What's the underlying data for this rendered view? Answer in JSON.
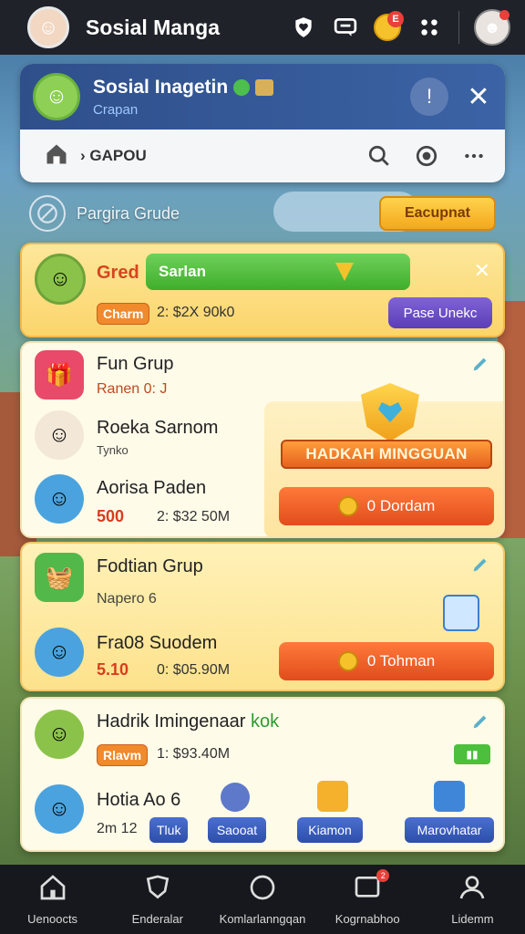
{
  "header": {
    "title": "Sosial Manga",
    "coin_badge": "E"
  },
  "group_header": {
    "name": "Sosial Inagetin",
    "subtitle": "Crapan",
    "breadcrumb": "GAPOU",
    "breadcrumb_sep": "›"
  },
  "filter": {
    "label": "Pargira Grude",
    "button": "Eacupnat"
  },
  "featured": {
    "name": "Gred",
    "bar_label": "Sarlan",
    "chip": "Charm",
    "stat": "2: $2X 90k0",
    "button": "Pase Unekc"
  },
  "group1": {
    "title": "Fun Grup",
    "subtitle": "Ranen 0: J",
    "member1": {
      "name": "Roeka Sarnom",
      "sub": "Tynko"
    },
    "member2": {
      "name": "Aorisa Paden",
      "num": "500",
      "stat": "2: $32 50M"
    },
    "promo": {
      "banner": "HADKAH MINGGUAN",
      "button": "0 Dordam"
    }
  },
  "group2": {
    "title": "Fodtian Grup",
    "subtitle": "Napero 6",
    "member": {
      "name": "Fra08 Suodem",
      "num": "5.10",
      "stat": "0: $05.90M"
    },
    "button": "0 Tohman"
  },
  "group3": {
    "title": "Hadrik Imingenaar",
    "title_accent": "kok",
    "chip": "Rlavm",
    "stat": "1: $93.40M",
    "member": {
      "name": "Hotia",
      "tag": "Ao 6",
      "sub": "2m 12"
    },
    "tags": [
      "Tluk",
      "Saooat",
      "Kiamon",
      "Marovhatar"
    ]
  },
  "nav": {
    "items": [
      {
        "label": "Uenoocts",
        "icon": "home-icon"
      },
      {
        "label": "Enderalar",
        "icon": "shield-icon"
      },
      {
        "label": "Komlarlanngqan",
        "icon": "circle-icon"
      },
      {
        "label": "Kogrnabhoo",
        "icon": "message-icon",
        "badge": "2"
      },
      {
        "label": "Lidemm",
        "icon": "profile-icon"
      }
    ]
  },
  "colors": {
    "topbar": "#1f2229",
    "accent_orange": "#e14c1c",
    "accent_green": "#4cbf3c",
    "accent_purple": "#5b3eb6",
    "badge_red": "#e8403a"
  }
}
